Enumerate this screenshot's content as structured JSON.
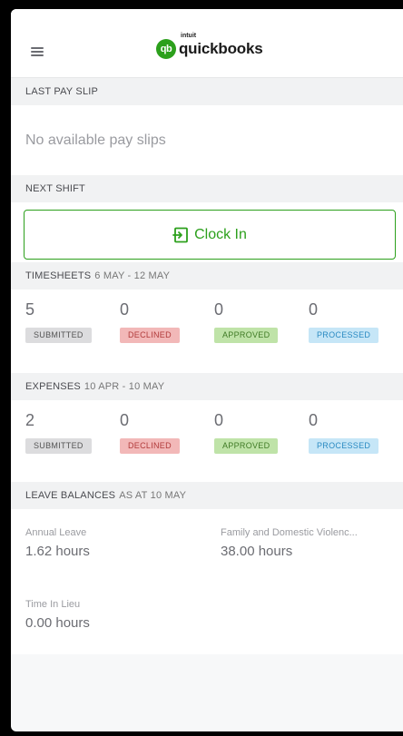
{
  "header": {
    "menu_icon": "hamburger-menu-icon",
    "logo_intuit": "intuit",
    "logo_text": "quickbooks",
    "logo_mark": "qb"
  },
  "last_pay_slip": {
    "title": "LAST PAY SLIP",
    "empty_text": "No available pay slips"
  },
  "next_shift": {
    "title": "NEXT SHIFT",
    "button_label": "Clock In",
    "button_icon": "clock-in-icon"
  },
  "timesheets": {
    "title": "TIMESHEETS",
    "range": "6 MAY - 12 MAY",
    "stats": [
      {
        "count": "5",
        "label": "SUBMITTED"
      },
      {
        "count": "0",
        "label": "DECLINED"
      },
      {
        "count": "0",
        "label": "APPROVED"
      },
      {
        "count": "0",
        "label": "PROCESSED"
      }
    ]
  },
  "expenses": {
    "title": "EXPENSES",
    "range": "10 APR - 10 MAY",
    "stats": [
      {
        "count": "2",
        "label": "SUBMITTED"
      },
      {
        "count": "0",
        "label": "DECLINED"
      },
      {
        "count": "0",
        "label": "APPROVED"
      },
      {
        "count": "0",
        "label": "PROCESSED"
      }
    ]
  },
  "leave_balances": {
    "title": "LEAVE BALANCES",
    "as_at": "AS AT 10 MAY",
    "items": [
      {
        "label": "Annual Leave",
        "value": "1.62 hours"
      },
      {
        "label": "Family and Domestic Violenc...",
        "value": "38.00 hours"
      },
      {
        "label": "Time In Lieu",
        "value": "0.00 hours"
      }
    ]
  },
  "colors": {
    "brand_green": "#2ca01c",
    "declined_bg": "#f2b8b8",
    "approved_bg": "#bfe3a8",
    "processed_bg": "#c6e6f7"
  }
}
